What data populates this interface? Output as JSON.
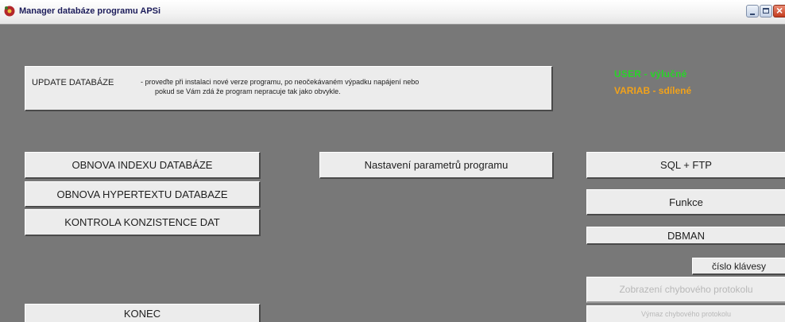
{
  "window": {
    "title": "Manager databáze programu APSi"
  },
  "update": {
    "title": "UPDATE   DATABÁZE",
    "desc_line1": "- proveďte při instalaci nové verze programu, po neočekávaném výpadku napájení nebo",
    "desc_line2": "pokud se Vám zdá že program nepracuje tak jako obvykle."
  },
  "legend": {
    "user": "USER - výlučné",
    "variab": "VARIAB - sdílené"
  },
  "buttons": {
    "obnova_indexu": "OBNOVA INDEXU DATABÁZE",
    "obnova_hypertextu": "OBNOVA HYPERTEXTU DATABAZE",
    "kontrola": "KONTROLA KONZISTENCE DAT",
    "konec": "KONEC",
    "nastaveni": "Nastavení parametrů programu",
    "sql_ftp": "SQL + FTP",
    "funkce": "Funkce",
    "dbman": "DBMAN",
    "cislo_klavesy": "číslo klávesy",
    "zobrazeni": "Zobrazení chybového protokolu",
    "vymaz": "Výmaz chybového protokolu"
  },
  "colors": {
    "background": "#787878",
    "user": "#28d428",
    "variab": "#f2a21a"
  }
}
